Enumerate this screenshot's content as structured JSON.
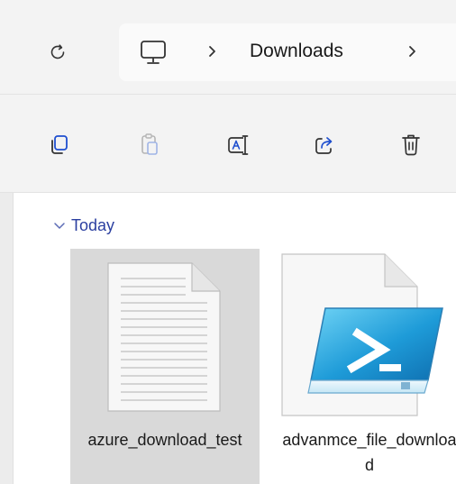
{
  "window": {
    "accent_color": "#2b3fa0",
    "selection_color": "#d9d9d9"
  },
  "addressbar": {
    "refresh_icon": "refresh-icon",
    "root_icon": "this-pc-icon",
    "breadcrumbs": [
      {
        "label": "Downloads"
      }
    ]
  },
  "commandbar": {
    "items": [
      {
        "icon": "copy-icon"
      },
      {
        "icon": "paste-icon"
      },
      {
        "icon": "rename-icon"
      },
      {
        "icon": "share-icon"
      },
      {
        "icon": "delete-icon"
      }
    ]
  },
  "content": {
    "group": {
      "label": "Today",
      "expanded": true
    },
    "files": [
      {
        "name": "azure_download_test",
        "icon": "text-document-icon",
        "selected": true
      },
      {
        "name": "advanmce_file_download",
        "icon": "powershell-script-icon",
        "selected": false
      }
    ]
  }
}
